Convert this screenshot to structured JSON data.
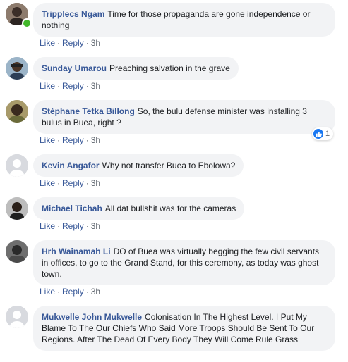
{
  "actions": {
    "like": "Like",
    "reply": "Reply",
    "separator": "·"
  },
  "comments": [
    {
      "author": "Tripplecs Ngam",
      "text": "Time for those propaganda are gone independence or nothing",
      "time": "3h",
      "online": true,
      "avatar": "photo-avatar"
    },
    {
      "author": "Sunday Umarou",
      "text": "Preaching salvation in the grave",
      "time": "3h",
      "avatar": "photo-avatar"
    },
    {
      "author": "Stéphane Tetka Billong",
      "text": "So, the bulu defense minister was installing 3 bulus in Buea, right ?",
      "time": "3h",
      "avatar": "photo-avatar",
      "reaction": {
        "icon": "thumbs-up-icon",
        "count": "1"
      }
    },
    {
      "author": "Kevin Angafor",
      "text": "Why not transfer Buea to Ebolowa?",
      "time": "3h",
      "avatar": "default-avatar"
    },
    {
      "author": "Michael Tichah",
      "text": "All dat bullshit was for the cameras",
      "time": "3h",
      "avatar": "photo-avatar"
    },
    {
      "author": "Hrh Wainamah Li",
      "text": "DO of Buea was virtually begging the few civil servants in offices, to go to the Grand Stand, for this ceremony, as today was ghost town.",
      "time": "3h",
      "avatar": "photo-avatar"
    },
    {
      "author": "Mukwelle John Mukwelle",
      "text": "Colonisation In The Highest Level. I Put My Blame To The Our Chiefs Who Said More Troops Should Be Sent To Our Regions. After The Dead Of Every Body They Will Come Rule Grass",
      "avatar": "default-avatar"
    }
  ],
  "colors": {
    "name": "#385898",
    "bubble": "#f2f3f5",
    "online": "#42b72a",
    "like_badge": "#1877f2"
  }
}
